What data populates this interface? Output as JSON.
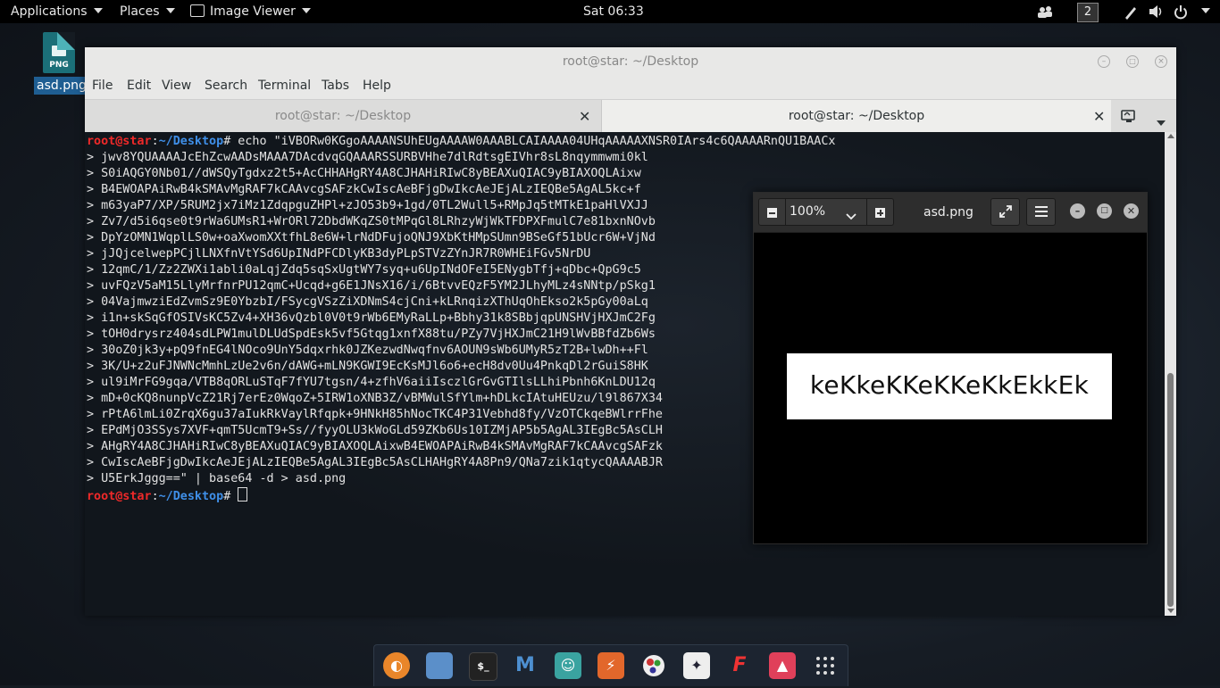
{
  "top_panel": {
    "applications": "Applications",
    "places": "Places",
    "active_app": "Image Viewer",
    "clock": "Sat 06:33",
    "workspace": "2"
  },
  "desktop": {
    "file_icon_type": "PNG",
    "file_label": "asd.png"
  },
  "terminal": {
    "title": "root@star: ~/Desktop",
    "menu": [
      "File",
      "Edit",
      "View",
      "Search",
      "Terminal",
      "Tabs",
      "Help"
    ],
    "tabs": [
      {
        "label": "root@star: ~/Desktop",
        "active": false
      },
      {
        "label": "root@star: ~/Desktop",
        "active": true
      }
    ],
    "prompt_user": "root@star",
    "prompt_path": "~/Desktop",
    "command_start": "# echo \"iVBORw0KGgoAAAANSUhEUgAAAAW0AAABLCAIAAAA04UHqAAAAAXNSR0IArs4c6QAAAARnQU1BAACx",
    "continuation_lines": [
      "> jwv8YQUAAAAJcEhZcwAADsMAAA7DAcdvqGQAAARSSURBVHhe7dlRdtsgEIVhr8sL8nqymmwmi0kl",
      "> S0iAQGY0Nb01//dWSQyTgdxz2t5+AcCHHAHgRY4A8CJHAHiRIwC8yBEAXuQIAC9yBIAXOQLAixw",
      "> B4EWOAPAiRwB4kSMAvMgRAF7kCAAvcgSAFzkCwIscAeBFjgDwIkcAeJEjALzIEQBe5AgAL5kc+f",
      "> m63yaP7/XP/5RUM2jx7iMz1ZdqpguZHPl+zJO53b9+1gd/0TL2Wull5+RMpJq5tMTkE1paHlVXJJ",
      "> Zv7/d5i6qse0t9rWa6UMsR1+WrORl72DbdWKqZS0tMPqGl8LRhzyWjWkTFDPXFmulC7e81bxnNOvb",
      "> DpYzOMN1WqplLS0w+oaXwomXXtfhL8e6W+lrNdDFujoQNJ9XbKtHMpSUmn9BSeGf51bUcr6W+VjNd",
      "> jJQjcelwepPCjlLNXfnVtYSd6UpINdPFCDlyKB3dyPLpSTVzZYnJR7R0WHEiFGv5NrDU",
      "> 12qmC/1/Zz2ZWXi1abli0aLqjZdq5sqSxUgtWY7syq+u6UpINdOFeI5ENygbTfj+qDbc+QpG9c5",
      "> uvFQzV5aM15LlyMrfnrPU12qmC+Ucqd+g6E1JNsX16/i/6BtvvEQzF5YM2JLhyMLz4sNNtp/pSkg1",
      "> 04VajmwziEdZvmSz9E0YbzbI/FSycgVSzZiXDNmS4cjCni+kLRnqizXThUqOhEkso2k5pGy00aLq",
      "> i1n+skSqGfOSIVsKC5Zv4+XH36vQzbl0V0t9rWb6EMyRaLLp+Bbhy31k8SBbjqpUNSHVjHXJmC2Fg",
      "> tOH0drysrz404sdLPW1mulDLUdSpdEsk5vf5Gtqg1xnfX88tu/PZy7VjHXJmC21H9lWvBBfdZb6Ws",
      "> 30oZ0jk3y+pQ9fnEG4lNOco9UnY5dqxrhk0JZKezwdNwqfnv6AOUN9sWb6UMyR5zT2B+lwDh++Fl",
      "> 3K/U+z2uFJNWNcMmhLzUe2v6n/dAWG+mLN9KGWI9EcKsMJl6o6+ecH8dv0Uu4PnkqDl2rGuiS8HK",
      "> ul9iMrFG9gqa/VTB8qORLuSTqF7fYU7tgsn/4+zfhV6aiiIsczlGrGvGTIlsLLhiPbnh6KnLDU12q",
      "> mD+0cKQ8nunpVcZ21Rj7erEz0WqoZ+5IRW1oXNB3Z/vBMWulSfYlm+hDLkcIAtuHEUzu/l9l867X34",
      "> rPtA6lmLi0ZrqX6gu37aIukRkVaylRfqpk+9HNkH85hNocTKC4P31Vebhd8fy/VzOTCkqeBWlrrFhe",
      "> EPdMjO3SSys7XVF+qmT5UcmT9+Ss//fyyOLU3kWoGLd59ZKb6Us10IZMjAP5b5AgAL3IEgBc5AsCLH",
      "> AHgRY4A8CJHAHiRIwC8yBEAXuQIAC9yBIAXOQLAixwB4EWOAPAiRwB4kSMAvMgRAF7kCAAvcgSAFzk",
      "> CwIscAeBFjgDwIkcAeJEjALzIEQBe5AgAL3IEgBc5AsCLHAHgRY4A8Pn9/QNa7zik1qtycQAAAABJR",
      "> U5ErkJggg==\" | base64 -d > asd.png"
    ]
  },
  "viewer": {
    "zoom": "100%",
    "title": "asd.png",
    "image_text": "keKkeKKeKKeKkEkkEk"
  },
  "dock": {
    "apps": [
      "firefox-icon",
      "files-icon",
      "terminal-icon",
      "metasploit-icon",
      "armitage-icon",
      "burpsuite-icon",
      "maltego-icon",
      "beef-icon",
      "faraday-icon",
      "image-viewer-icon",
      "show-apps-icon"
    ]
  }
}
